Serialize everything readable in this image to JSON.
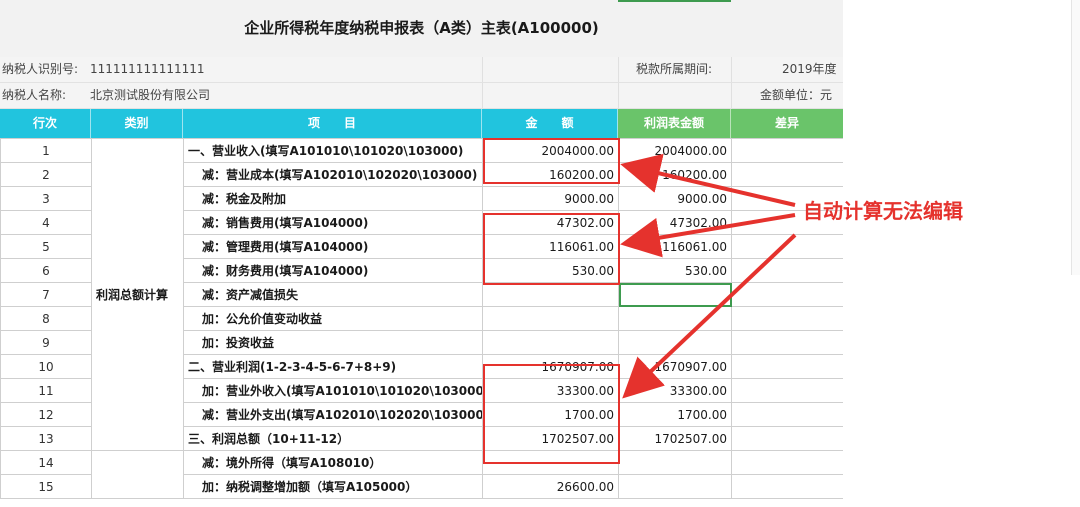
{
  "form": {
    "title": "企业所得税年度纳税申报表（A类）主表(A100000)",
    "taxpayer_id_label": "纳税人识别号:",
    "taxpayer_id_value": "111111111111111",
    "taxpayer_name_label": "纳税人名称:",
    "taxpayer_name_value": "北京测试股份有限公司",
    "tax_period_label": "税款所属期间:",
    "tax_period_value": "2019年度",
    "unit_label": "金额单位：元"
  },
  "columns": {
    "row_no": "行次",
    "category": "类别",
    "item": "项　　目",
    "amount": "金　　额",
    "profit_amount": "利润表金额",
    "difference": "差异"
  },
  "category_label": "利润总额计算",
  "rows": [
    {
      "no": "1",
      "item": "一、营业收入(填写A101010\\101020\\103000)",
      "amount": "2004000.00",
      "profit": "2004000.00"
    },
    {
      "no": "2",
      "item": "减：营业成本(填写A102010\\102020\\103000)",
      "amount": "160200.00",
      "profit": "160200.00"
    },
    {
      "no": "3",
      "item": "减：税金及附加",
      "amount": "9000.00",
      "profit": "9000.00"
    },
    {
      "no": "4",
      "item": "减：销售费用(填写A104000)",
      "amount": "47302.00",
      "profit": "47302.00"
    },
    {
      "no": "5",
      "item": "减：管理费用(填写A104000)",
      "amount": "116061.00",
      "profit": "116061.00"
    },
    {
      "no": "6",
      "item": "减：财务费用(填写A104000)",
      "amount": "530.00",
      "profit": "530.00"
    },
    {
      "no": "7",
      "item": "减：资产减值损失",
      "amount": "",
      "profit": ""
    },
    {
      "no": "8",
      "item": "加：公允价值变动收益",
      "amount": "",
      "profit": ""
    },
    {
      "no": "9",
      "item": "加：投资收益",
      "amount": "",
      "profit": ""
    },
    {
      "no": "10",
      "item": "二、营业利润(1-2-3-4-5-6-7+8+9)",
      "amount": "1670907.00",
      "profit": "1670907.00"
    },
    {
      "no": "11",
      "item": "加：营业外收入(填写A101010\\101020\\103000)",
      "amount": "33300.00",
      "profit": "33300.00"
    },
    {
      "no": "12",
      "item": "减：营业外支出(填写A102010\\102020\\103000)",
      "amount": "1700.00",
      "profit": "1700.00"
    },
    {
      "no": "13",
      "item": "三、利润总额（10+11-12）",
      "amount": "1702507.00",
      "profit": "1702507.00"
    },
    {
      "no": "14",
      "item": "减：境外所得（填写A108010）",
      "amount": "",
      "profit": ""
    },
    {
      "no": "15",
      "item": "加：纳税调整增加额（填写A105000）",
      "amount": "26600.00",
      "profit": ""
    }
  ],
  "annotation": {
    "text": "自动计算无法编辑",
    "color": "#e5322d"
  },
  "colors": {
    "header_cyan": "#21c4de",
    "header_green": "#6ac46a",
    "selection_green": "#3e9b4f"
  }
}
